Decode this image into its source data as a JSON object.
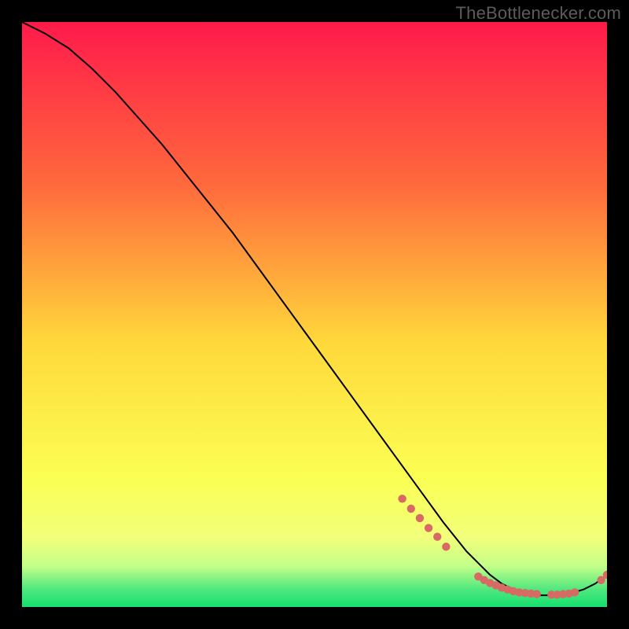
{
  "attribution": "TheBottlenecker.com",
  "colors": {
    "bg": "#000000",
    "grad_top": "#ff1a4b",
    "grad_mid_upper": "#ff7a3a",
    "grad_mid": "#ffd93b",
    "grad_lower": "#f7ff66",
    "grad_green_light": "#9dff8c",
    "grad_green": "#15e06e",
    "line": "#000000",
    "dot": "#d76a63",
    "attribution_text": "#5c5c5c"
  },
  "chart_data": {
    "type": "line",
    "title": "",
    "xlabel": "",
    "ylabel": "",
    "xlim": [
      0,
      100
    ],
    "ylim": [
      0,
      100
    ],
    "series": [
      {
        "name": "bottleneck-curve",
        "x": [
          0,
          4,
          8,
          12,
          16,
          20,
          24,
          28,
          32,
          36,
          40,
          44,
          48,
          52,
          56,
          60,
          64,
          68,
          72,
          74,
          76,
          78,
          80,
          82,
          84,
          86,
          88,
          90,
          92,
          94,
          96,
          98,
          100
        ],
        "y": [
          100,
          98,
          95.5,
          92,
          88,
          83.5,
          79,
          74,
          69,
          64,
          58.5,
          53,
          47.5,
          42,
          36.5,
          31,
          25.5,
          20,
          14.5,
          12,
          9.5,
          7.5,
          5.5,
          4,
          3,
          2.3,
          2,
          2,
          2.1,
          2.4,
          3,
          4,
          5.5
        ]
      }
    ],
    "dots": {
      "name": "highlight-dots",
      "points": [
        {
          "x": 65,
          "y": 18.5
        },
        {
          "x": 66.5,
          "y": 16.8
        },
        {
          "x": 68,
          "y": 15.2
        },
        {
          "x": 69.5,
          "y": 13.5
        },
        {
          "x": 71,
          "y": 12
        },
        {
          "x": 72.5,
          "y": 10.3
        },
        {
          "x": 78,
          "y": 5.2
        },
        {
          "x": 79,
          "y": 4.6
        },
        {
          "x": 80,
          "y": 4.1
        },
        {
          "x": 81,
          "y": 3.7
        },
        {
          "x": 82,
          "y": 3.3
        },
        {
          "x": 83,
          "y": 3.0
        },
        {
          "x": 84,
          "y": 2.7
        },
        {
          "x": 85,
          "y": 2.5
        },
        {
          "x": 86,
          "y": 2.4
        },
        {
          "x": 87,
          "y": 2.3
        },
        {
          "x": 88,
          "y": 2.2
        },
        {
          "x": 90.5,
          "y": 2.1
        },
        {
          "x": 91.5,
          "y": 2.1
        },
        {
          "x": 92.5,
          "y": 2.2
        },
        {
          "x": 93.5,
          "y": 2.3
        },
        {
          "x": 94.5,
          "y": 2.5
        },
        {
          "x": 99,
          "y": 4.6
        },
        {
          "x": 100,
          "y": 5.5
        }
      ]
    },
    "micro_label": {
      "text": "",
      "x": 84,
      "y": 2.5
    }
  }
}
